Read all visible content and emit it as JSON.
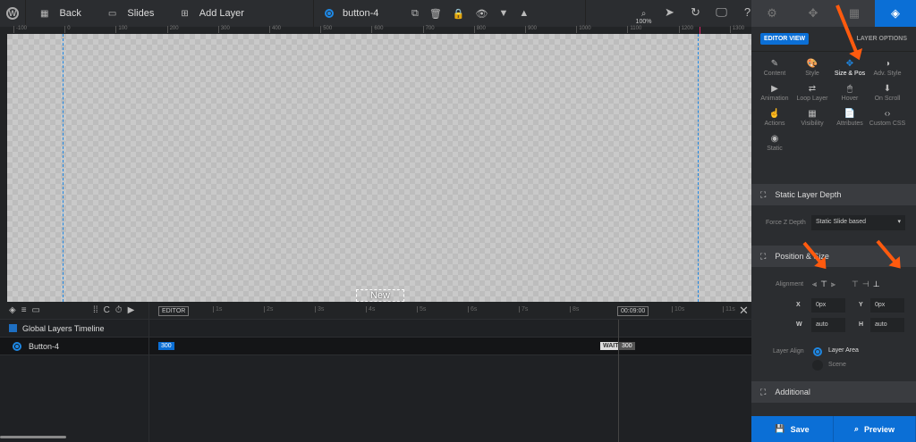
{
  "topbar": {
    "wp_icon": "W",
    "back": "Back",
    "slides": "Slides",
    "add_layer": "Add Layer",
    "layer_name": "button-4",
    "zoom": "100%"
  },
  "ruler": {
    "labels": [
      "-100",
      "0",
      "100",
      "200",
      "300",
      "400",
      "500",
      "600",
      "700",
      "800",
      "900",
      "1000",
      "1100",
      "1200",
      "1300"
    ]
  },
  "canvas": {
    "layer_label": "New Layer"
  },
  "timeline": {
    "editor": "EDITOR",
    "ticks": [
      "1s",
      "2s",
      "3s",
      "4s",
      "5s",
      "6s",
      "7s",
      "8s",
      "10s",
      "11s"
    ],
    "current_time": "00:09:00",
    "global": "Global Layers Timeline",
    "layer": "Button-4",
    "start": "300",
    "wait": "WAIT",
    "end": "300"
  },
  "sidebar": {
    "editor_view": "EDITOR VIEW",
    "layer_options": "LAYER OPTIONS",
    "items": [
      {
        "label": "Content",
        "icon": "✎"
      },
      {
        "label": "Style",
        "icon": "🎨"
      },
      {
        "label": "Size & Pos",
        "icon": "✥"
      },
      {
        "label": "Adv. Style",
        "icon": "◑"
      },
      {
        "label": "Animation",
        "icon": "▶"
      },
      {
        "label": "Loop Layer",
        "icon": "⇄"
      },
      {
        "label": "Hover",
        "icon": "🖱"
      },
      {
        "label": "On Scroll",
        "icon": "⬇"
      },
      {
        "label": "Actions",
        "icon": "☝"
      },
      {
        "label": "Visibility",
        "icon": "▦"
      },
      {
        "label": "Attributes",
        "icon": "📄"
      },
      {
        "label": "Custom CSS",
        "icon": "‹›"
      },
      {
        "label": "Static",
        "icon": "◉"
      }
    ],
    "static_depth": "Static Layer Depth",
    "force_z": "Force Z Depth",
    "force_z_value": "Static Slide based",
    "pos_size": "Position & Size",
    "alignment": "Alignment",
    "x_label": "X",
    "x_value": "0px",
    "y_label": "Y",
    "y_value": "0px",
    "w_label": "W",
    "w_value": "auto",
    "h_label": "H",
    "h_value": "auto",
    "layer_align": "Layer Align",
    "layer_area": "Layer Area",
    "scene": "Scene",
    "additional": "Additional",
    "save": "Save",
    "preview": "Preview"
  },
  "colors": {
    "accent": "#0b6fd6",
    "arrow": "#ff5a0e"
  }
}
